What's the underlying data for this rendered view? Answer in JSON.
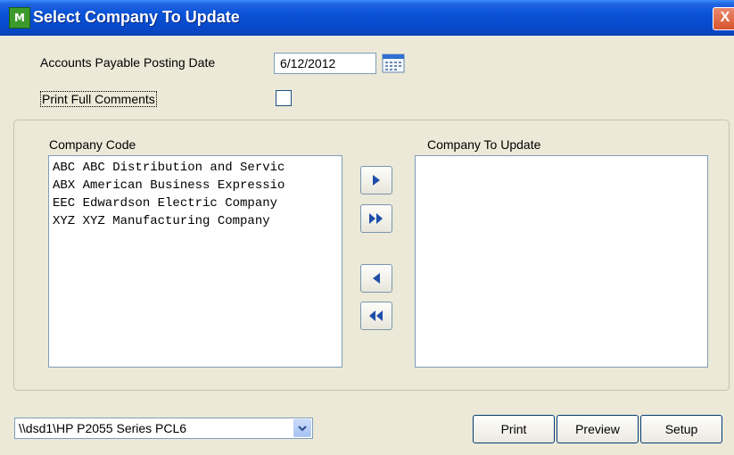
{
  "window": {
    "title": "Select Company To Update",
    "icon_label": "M",
    "close_label": "X"
  },
  "form": {
    "posting_date_label": "Accounts Payable Posting Date",
    "posting_date_value": "6/12/2012",
    "print_full_comments_label": "Print Full Comments",
    "print_full_comments_checked": false
  },
  "lists": {
    "company_code_label": "Company Code",
    "company_to_update_label": "Company To Update",
    "company_codes": [
      "ABC ABC Distribution and Servic",
      "ABX American Business Expressio",
      "EEC Edwardson Electric Company",
      "XYZ XYZ Manufacturing Company"
    ],
    "companies_to_update": []
  },
  "printer": {
    "selected": "\\\\dsd1\\HP P2055 Series PCL6"
  },
  "buttons": {
    "print": "Print",
    "preview": "Preview",
    "setup": "Setup"
  },
  "icons": {
    "calendar": "calendar-icon",
    "move_right": "arrow-right-icon",
    "move_all_right": "double-arrow-right-icon",
    "move_left": "arrow-left-icon",
    "move_all_left": "double-arrow-left-icon",
    "dropdown": "chevron-down-icon"
  },
  "colors": {
    "title_bar": "#0a52d8",
    "window_bg": "#ece9d8",
    "arrow_glyph": "#1e4fa8"
  }
}
